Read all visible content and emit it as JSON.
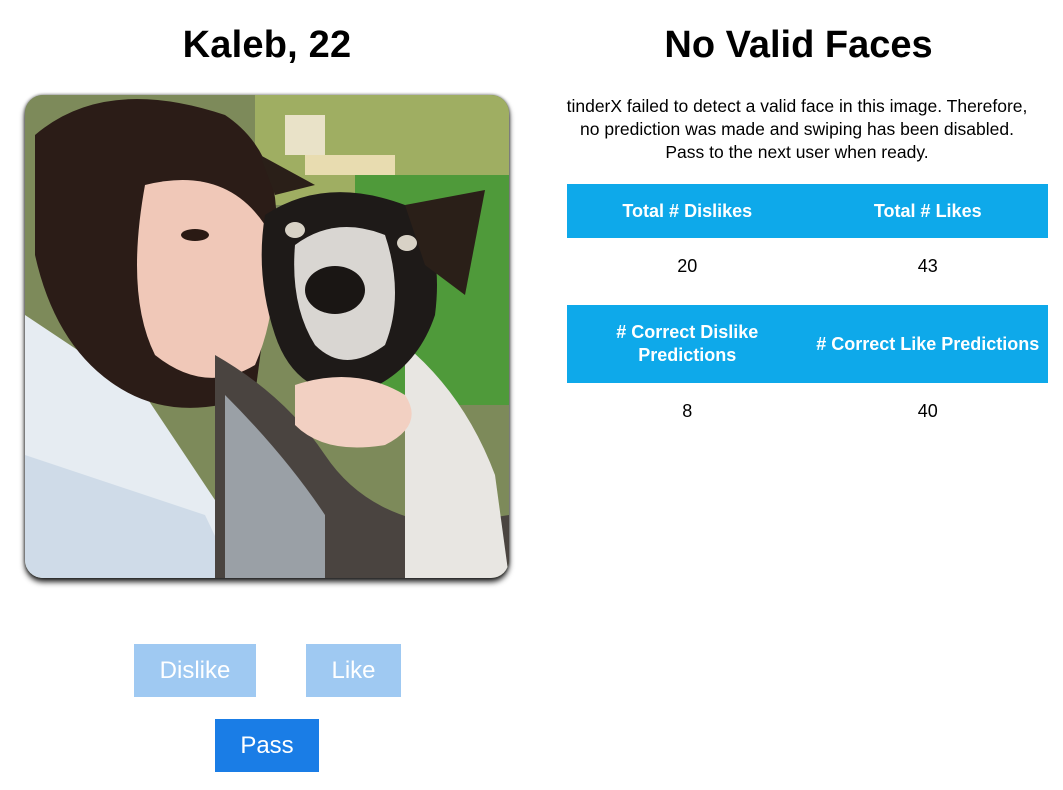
{
  "profile": {
    "name_age": "Kaleb, 22"
  },
  "buttons": {
    "dislike_label": "Dislike",
    "like_label": "Like",
    "pass_label": "Pass"
  },
  "status": {
    "title": "No Valid Faces",
    "message": "tinderX failed to detect a valid face in this image. Therefore, no prediction was made and swiping has been disabled. Pass to the next user when ready."
  },
  "totals_table": {
    "headers": [
      "Total # Dislikes",
      "Total # Likes"
    ],
    "values": [
      "20",
      "43"
    ]
  },
  "predictions_table": {
    "headers": [
      "# Correct Dislike Predictions",
      "# Correct Like Predictions"
    ],
    "values": [
      "8",
      "40"
    ]
  },
  "colors": {
    "header_bg": "#0ea9ea",
    "disabled_button": "#9fc9f2",
    "active_button": "#1a7de6"
  }
}
